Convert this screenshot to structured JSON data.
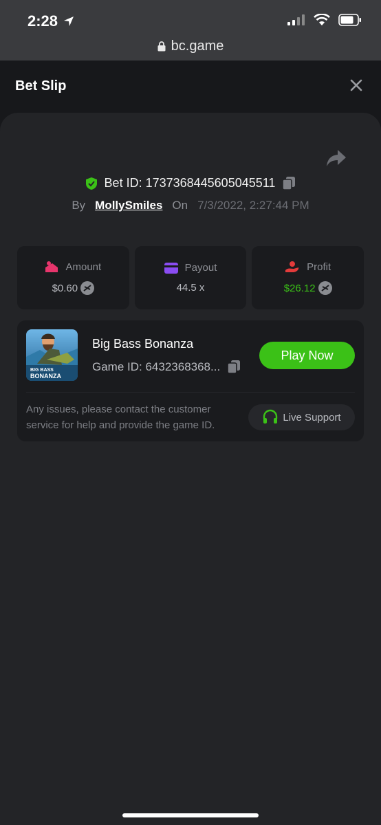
{
  "status_bar": {
    "time": "2:28",
    "url": "bc.game"
  },
  "header": {
    "title": "Bet Slip"
  },
  "bet": {
    "id_label": "Bet ID: 1737368445605045511",
    "by_label": "By",
    "user": "MollySmiles",
    "on_label": "On",
    "datetime": "7/3/2022, 2:27:44 PM"
  },
  "stats": {
    "amount": {
      "label": "Amount",
      "value": "$0.60"
    },
    "payout": {
      "label": "Payout",
      "value": "44.5 x"
    },
    "profit": {
      "label": "Profit",
      "value": "$26.12"
    }
  },
  "game": {
    "name": "Big Bass Bonanza",
    "id_label": "Game ID: 6432368368...",
    "play_label": "Play Now",
    "thumb_text_1": "BIG BASS",
    "thumb_text_2": "BONANZA",
    "help_text": "Any issues, please contact the customer service for help and provide the game ID.",
    "support_label": "Live Support"
  },
  "colors": {
    "accent_green": "#3bc117",
    "background": "#17181b",
    "panel": "#232427",
    "card": "#1a1b1e"
  }
}
